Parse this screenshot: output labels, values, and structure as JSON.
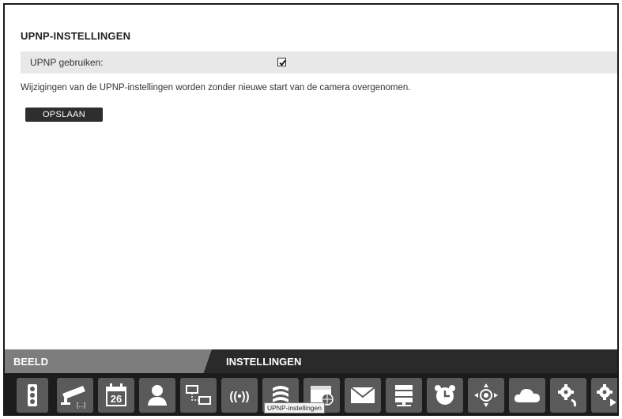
{
  "settings": {
    "title": "UPNP-INSTELLINGEN",
    "upnp_label": "UPNP gebruiken:",
    "upnp_checked": true,
    "info": "Wijzigingen van de UPNP-instellingen worden zonder nieuwe start van de camera overgenomen.",
    "save_label": "OPSLAAN"
  },
  "tabs": {
    "beeld": "BEELD",
    "instellingen": "INSTELLINGEN"
  },
  "calendar_day": "26",
  "wireless_glyph": "((•))",
  "tooltip": "UPNP-instellingen",
  "icons": [
    "traffic-light-icon",
    "camera-icon",
    "calendar-icon",
    "user-icon",
    "network-icon",
    "wireless-icon",
    "upnp-icon",
    "web-icon",
    "mail-icon",
    "server-icon",
    "alarm-clock-icon",
    "ptz-icon",
    "cloud-icon",
    "gear-refresh-icon",
    "gear-play-icon"
  ]
}
